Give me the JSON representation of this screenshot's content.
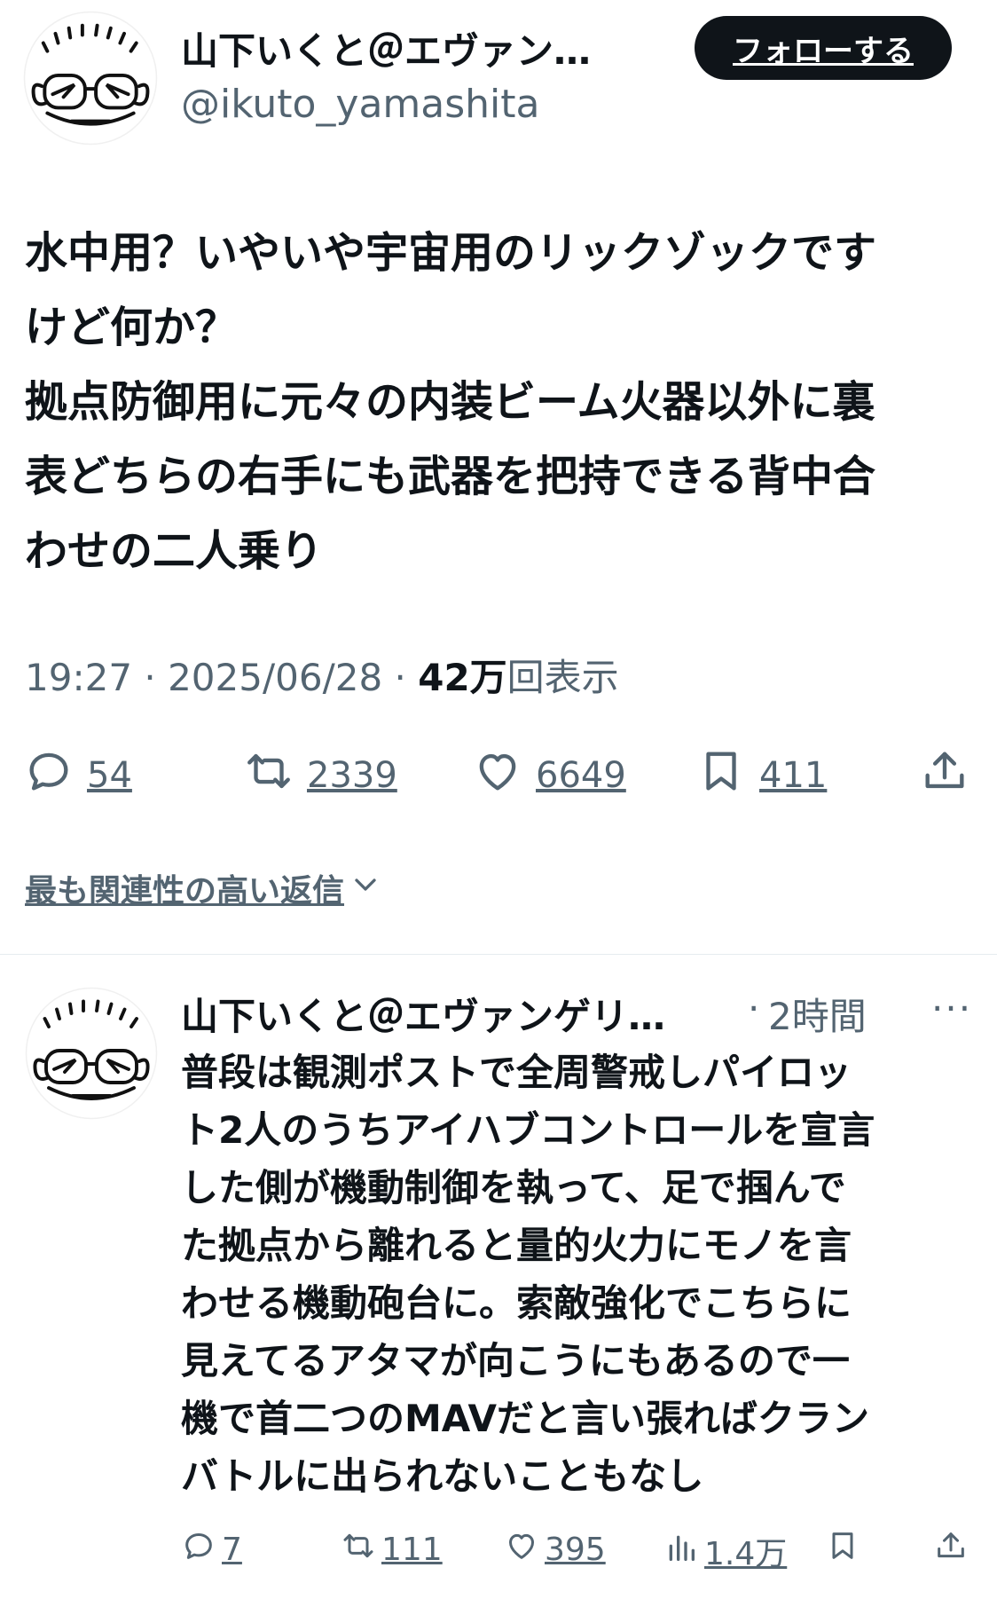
{
  "tweet": {
    "author_name": "山下いくと＠エヴァン…",
    "handle": "@ikuto_yamashita",
    "follow_label": "フォローする",
    "text_lines": [
      "水中用？いやいや宇宙用のリックゾックです",
      "けど何か？",
      "拠点防御用に元々の内装ビーム火器以外に裏",
      "表どちらの右手にも武器を把持できる背中合",
      "わせの二人乗り"
    ],
    "time": "19:27 · 2025/06/28 · ",
    "views_count": "42万",
    "views_label": "回表示",
    "actions": {
      "replies": "54",
      "reposts": "2339",
      "likes": "6649",
      "bookmarks": "411"
    }
  },
  "replies_filter_label": "最も関連性の高い返信",
  "reply": {
    "author_name": "山下いくと＠エヴァンゲリ…",
    "separator": "·",
    "time": "2時間",
    "more": "···",
    "text_lines": [
      "普段は観測ポストで全周警戒しパイロッ",
      "ト2人のうちアイハブコントロールを宣言",
      "した側が機動制御を執って、足で掴んで",
      "た拠点から離れると量的火力にモノを言",
      "わせる機動砲台に。索敵強化でこちらに",
      "見えてるアタマが向こうにもあるので一",
      "機で首二つのMAVだと言い張ればクラン",
      "バトルに出られないこともなし"
    ],
    "actions": {
      "replies": "7",
      "reposts": "111",
      "likes": "395",
      "views": "1.4万"
    }
  },
  "icons": {
    "reply": "speech-bubble-icon",
    "repost": "repost-icon",
    "like": "heart-icon",
    "bookmark": "bookmark-icon",
    "share": "share-icon",
    "views": "bar-chart-icon",
    "chevron": "chevron-down-icon"
  },
  "colors": {
    "text": "#0f1419",
    "secondary": "#536471",
    "button_bg": "#0f1419",
    "button_text": "#ffffff",
    "divider": "#e6ecf0"
  }
}
